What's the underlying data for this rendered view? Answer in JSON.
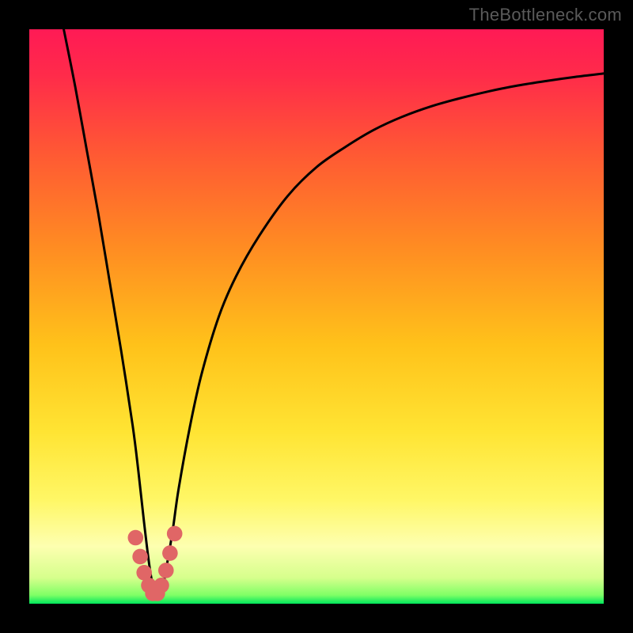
{
  "attribution": "TheBottleneck.com",
  "gradient": {
    "stops": [
      {
        "offset": 0.0,
        "color": "#ff1a55"
      },
      {
        "offset": 0.08,
        "color": "#ff2b4a"
      },
      {
        "offset": 0.22,
        "color": "#ff5a33"
      },
      {
        "offset": 0.38,
        "color": "#ff8c22"
      },
      {
        "offset": 0.55,
        "color": "#ffc21a"
      },
      {
        "offset": 0.7,
        "color": "#ffe433"
      },
      {
        "offset": 0.82,
        "color": "#fff766"
      },
      {
        "offset": 0.9,
        "color": "#fdffb0"
      },
      {
        "offset": 0.955,
        "color": "#d6ff8c"
      },
      {
        "offset": 0.985,
        "color": "#7fff66"
      },
      {
        "offset": 1.0,
        "color": "#00e65c"
      }
    ]
  },
  "chart_data": {
    "type": "line",
    "title": "",
    "xlabel": "",
    "ylabel": "",
    "xlim": [
      0,
      100
    ],
    "ylim": [
      0,
      100
    ],
    "x_min_at": 22,
    "series": [
      {
        "name": "bottleneck-curve",
        "x": [
          6,
          8,
          10,
          12,
          14,
          16,
          18,
          19,
          20,
          21,
          22,
          23,
          24,
          25,
          26,
          28,
          30,
          33,
          36,
          40,
          45,
          50,
          55,
          60,
          65,
          70,
          75,
          80,
          85,
          90,
          95,
          100
        ],
        "y": [
          100,
          90,
          79,
          68,
          56,
          44,
          31,
          23,
          14,
          6,
          1,
          2,
          7,
          13,
          20,
          31,
          40,
          50,
          57,
          64,
          71,
          76,
          79.5,
          82.5,
          84.8,
          86.6,
          88,
          89.2,
          90.2,
          91,
          91.7,
          92.3
        ]
      }
    ],
    "valley_markers": {
      "x": [
        18.5,
        19.3,
        20.0,
        20.8,
        21.5,
        22.3,
        23.0,
        23.8,
        24.5,
        25.3
      ],
      "y": [
        11.5,
        8.2,
        5.4,
        3.2,
        1.8,
        1.8,
        3.2,
        5.8,
        8.8,
        12.2
      ],
      "color": "#e06666",
      "radius_pct": 1.35
    }
  }
}
